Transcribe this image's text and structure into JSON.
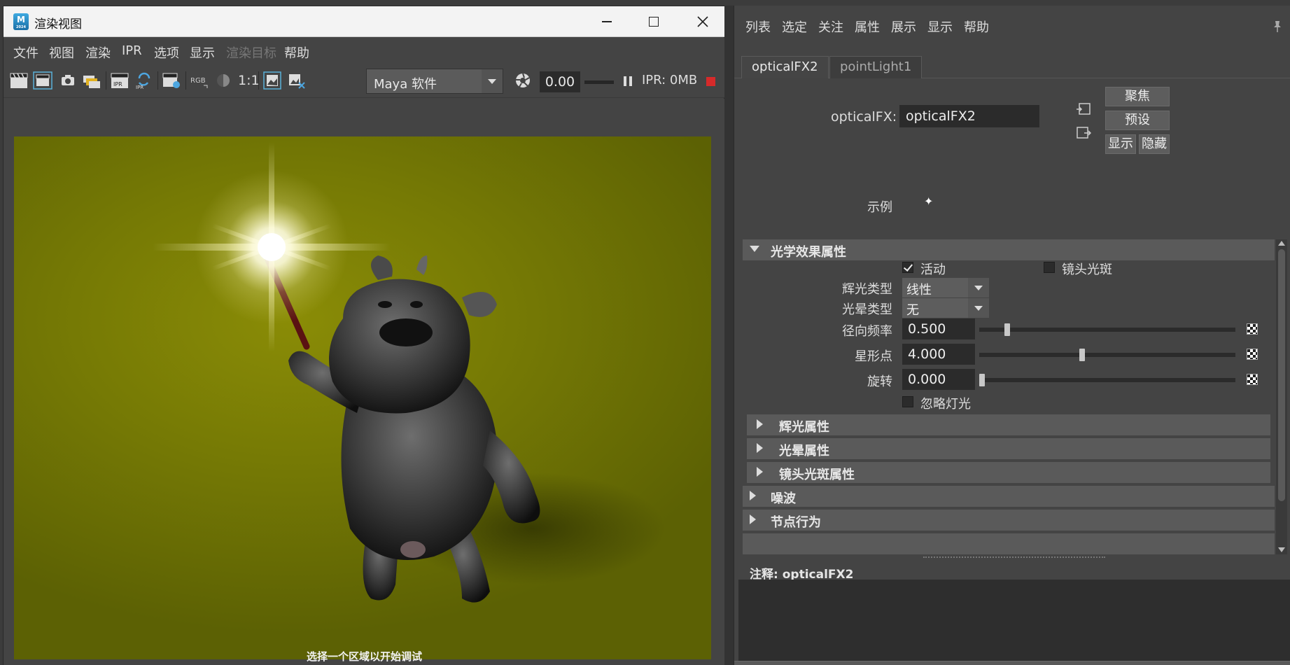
{
  "render_view": {
    "title": "渲染视图",
    "menu": [
      "文件",
      "视图",
      "渲染",
      "IPR",
      "选项",
      "显示",
      "渲染目标",
      "帮助"
    ],
    "toolbar": {
      "rgb_label": "RGB",
      "ratio_label": "1:1",
      "renderer": "Maya 软件",
      "time_value": "0.00",
      "ipr_memory": "IPR: 0MB"
    },
    "status_text": "选择一个区域以开始调试",
    "colors": {
      "stop": "#d62a2a",
      "background": "#767a05"
    }
  },
  "attribute_editor": {
    "menu": [
      "列表",
      "选定",
      "关注",
      "属性",
      "展示",
      "显示",
      "帮助"
    ],
    "tabs": [
      "opticalFX2",
      "pointLight1"
    ],
    "active_tab": "opticalFX2",
    "node_label": "opticalFX:",
    "node_name": "opticalFX2",
    "buttons": {
      "focus": "聚焦",
      "presets": "预设",
      "show": "显示",
      "hide": "隐藏"
    },
    "sample_label": "示例",
    "sections": {
      "optical": "光学效果属性",
      "glow": "辉光属性",
      "halo": "光晕属性",
      "lens_flare": "镜头光斑属性",
      "noise": "噪波",
      "node_behavior": "节点行为"
    },
    "attrs": {
      "active_label": "活动",
      "active_checked": true,
      "lens_flare_label": "镜头光斑",
      "lens_flare_checked": false,
      "glow_type_label": "辉光类型",
      "glow_type": "线性",
      "halo_type_label": "光晕类型",
      "halo_type": "无",
      "radial_freq_label": "径向频率",
      "radial_freq": "0.500",
      "star_points_label": "星形点",
      "star_points": "4.000",
      "rotation_label": "旋转",
      "rotation": "0.000",
      "ignore_light_label": "忽略灯光",
      "ignore_light_checked": false
    },
    "sliders": {
      "radial_freq": 0.1,
      "star_points": 0.4,
      "rotation": 0.0
    },
    "notes_label": "注释: opticalFX2"
  }
}
